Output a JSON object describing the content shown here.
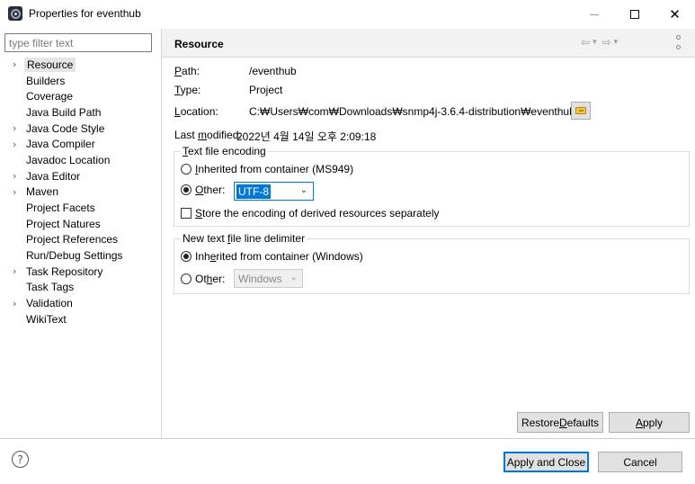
{
  "window": {
    "title": "Properties for eventhub",
    "minimize_glyph": "—",
    "maximize_glyph": "☐",
    "close_glyph": "✕"
  },
  "filter": {
    "placeholder": "type filter text",
    "value": ""
  },
  "tree": {
    "items": [
      {
        "label": "Resource",
        "expandable": true,
        "selected": true
      },
      {
        "label": "Builders",
        "expandable": false
      },
      {
        "label": "Coverage",
        "expandable": false
      },
      {
        "label": "Java Build Path",
        "expandable": false
      },
      {
        "label": "Java Code Style",
        "expandable": true
      },
      {
        "label": "Java Compiler",
        "expandable": true
      },
      {
        "label": "Javadoc Location",
        "expandable": false
      },
      {
        "label": "Java Editor",
        "expandable": true
      },
      {
        "label": "Maven",
        "expandable": true
      },
      {
        "label": "Project Facets",
        "expandable": false
      },
      {
        "label": "Project Natures",
        "expandable": false
      },
      {
        "label": "Project References",
        "expandable": false
      },
      {
        "label": "Run/Debug Settings",
        "expandable": false
      },
      {
        "label": "Task Repository",
        "expandable": true
      },
      {
        "label": "Task Tags",
        "expandable": false
      },
      {
        "label": "Validation",
        "expandable": true
      },
      {
        "label": "WikiText",
        "expandable": false
      }
    ]
  },
  "page": {
    "title": "Resource",
    "path_label": "Path:",
    "path_value": "/eventhub",
    "type_label": "Type:",
    "type_value": "Project",
    "location_label": "Location:",
    "location_value": "C:₩Users₩com₩Downloads₩snmp4j-3.6.4-distribution₩eventhub",
    "modified_label": "Last modified:",
    "modified_value": "2022년 4월 14일 오후 2:09:18"
  },
  "encoding": {
    "legend": "Text file encoding",
    "inherited_label": "Inherited from container (MS949)",
    "other_label": "Other:",
    "other_value": "UTF-8",
    "store_label": "Store the encoding of derived resources separately"
  },
  "delimiter": {
    "legend": "New text file line delimiter",
    "inherited_label": "Inherited from container (Windows)",
    "other_label": "Other:",
    "other_value": "Windows"
  },
  "buttons": {
    "restore_defaults": "Restore Defaults",
    "apply": "Apply",
    "apply_and_close": "Apply and Close",
    "cancel": "Cancel"
  },
  "icons": {
    "help": "?",
    "back": "⇦",
    "forward": "⇨",
    "dropdown": "▾",
    "chevron_right": "›",
    "chevron_down": "⌄"
  },
  "colors": {
    "accent": "#0078d7",
    "selection": "#e5e5e5",
    "header_bg": "#f2f2f2"
  }
}
